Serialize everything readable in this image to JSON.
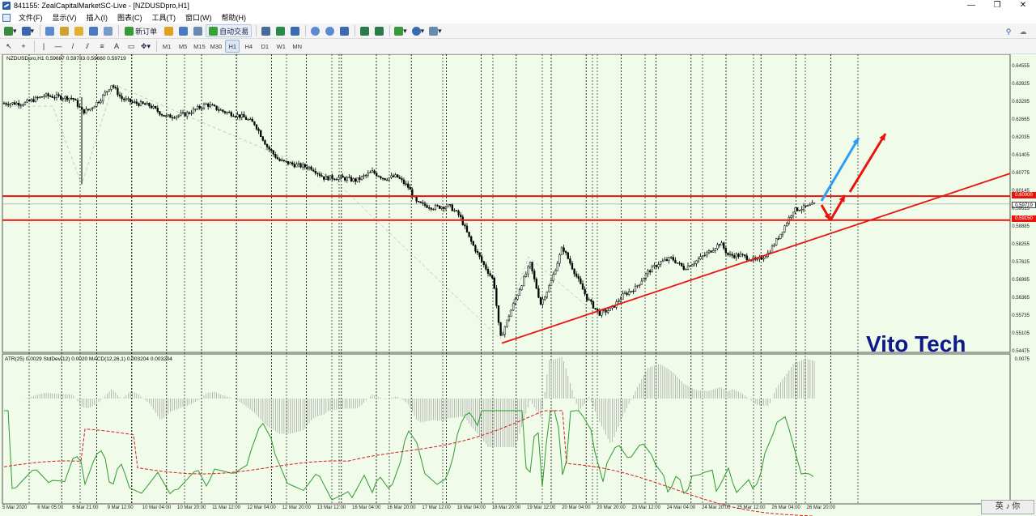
{
  "window": {
    "title": "841155: ZealCapitalMarketSC-Live - [NZDUSDpro,H1]",
    "controls": [
      "—",
      "❐",
      "✕"
    ]
  },
  "menu": [
    "文件(F)",
    "显示(V)",
    "插入(I)",
    "图表(C)",
    "工具(T)",
    "窗口(W)",
    "帮助(H)"
  ],
  "toolbar": {
    "new_order_label": "新订单",
    "autotrade_label": "自动交易"
  },
  "timeframes": [
    "M1",
    "M5",
    "M15",
    "M30",
    "H1",
    "H4",
    "D1",
    "W1",
    "MN"
  ],
  "active_timeframe": "H1",
  "chart": {
    "info": "NZDUSDpro,H1  0.59687 0.59733 0.59660 0.59719",
    "indicator_info": "ATR(25) 0.0029  StdDev(12) 0.0020  MACD(12,26,1) 0.003204 0.003204",
    "watermark": "Vito Tech",
    "ime_text": "英 ♪ 你",
    "price_ticks": [
      "0.64555",
      "0.63925",
      "0.63295",
      "0.62665",
      "0.62035",
      "0.61405",
      "0.60775",
      "0.60145",
      "0.59515",
      "0.58885",
      "0.58255",
      "0.57625",
      "0.56995",
      "0.56365",
      "0.55735",
      "0.55105",
      "0.54475"
    ],
    "price_tag_resistance": "0.60000",
    "price_tag_current": "0.59719",
    "price_tag_support": "0.59150",
    "indicator_tick": "0.0075",
    "time_labels": [
      "5 Mar 2020",
      "6 Mar 05:00",
      "6 Mar 21:00",
      "9 Mar 12:00",
      "10 Mar 04:00",
      "10 Mar 20:00",
      "11 Mar 12:00",
      "12 Mar 04:00",
      "12 Mar 20:00",
      "13 Mar 12:00",
      "16 Mar 04:00",
      "16 Mar 20:00",
      "17 Mar 12:00",
      "18 Mar 04:00",
      "18 Mar 20:00",
      "19 Mar 12:00",
      "20 Mar 04:00",
      "20 Mar 20:00",
      "23 Mar 12:00",
      "24 Mar 04:00",
      "24 Mar 20:00",
      "25 Mar 12:00",
      "26 Mar 04:00",
      "26 Mar 20:00"
    ],
    "colors": {
      "background": "#f0fbe9",
      "candles": "#000000",
      "levels": "#e8140c",
      "trendline": "#e8140c",
      "arrow_blue": "#2a9df4",
      "arrow_red": "#e8140c",
      "macd_hist": "#a8a8a8",
      "atr": "#2e9a2e",
      "stddev": "#d42020"
    }
  }
}
